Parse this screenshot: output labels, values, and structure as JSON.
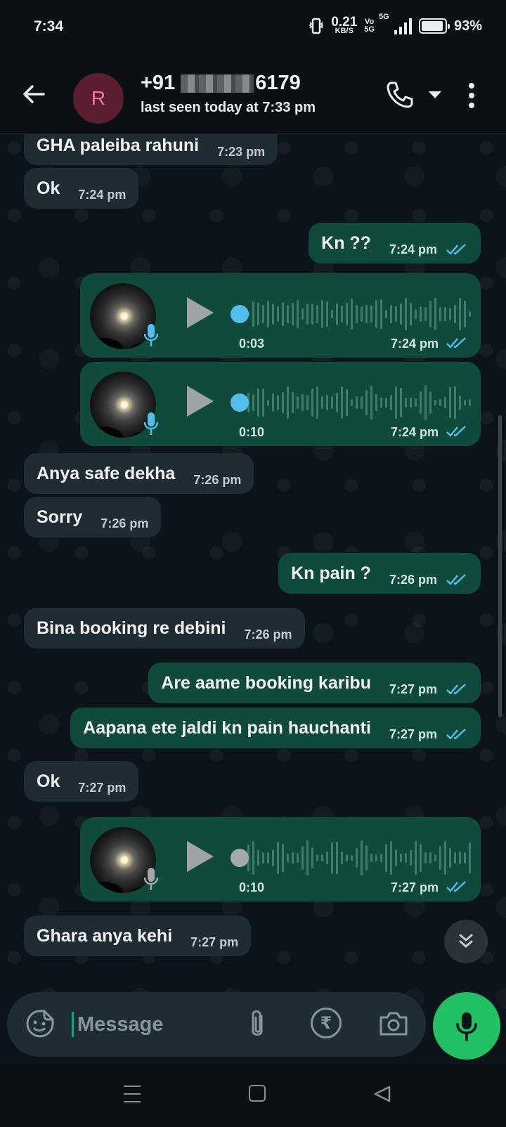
{
  "status_bar": {
    "time": "7:34",
    "speed_value": "0.21",
    "speed_unit": "KB/S",
    "vo_top": "Vo",
    "vo_bottom": "5G",
    "network": "5G",
    "battery": "93%",
    "battery_level": 0.93
  },
  "header": {
    "avatar_letter": "R",
    "number_prefix": "+91",
    "number_suffix": "6179",
    "last_seen": "last seen today at 7:33 pm",
    "avatar_color": "#5b1d30"
  },
  "messages": [
    {
      "dir": "in",
      "text": "GHA paleiba rahuni",
      "time": "7:23 pm"
    },
    {
      "dir": "in",
      "text": "Ok",
      "time": "7:24 pm"
    },
    {
      "dir": "out",
      "text": "Kn ??",
      "time": "7:24 pm",
      "status": "read"
    },
    {
      "dir": "out",
      "type": "voice",
      "duration": "0:03",
      "time": "7:24 pm",
      "status": "read",
      "progress": 0
    },
    {
      "dir": "out",
      "type": "voice",
      "duration": "0:10",
      "time": "7:24 pm",
      "status": "read",
      "progress": 0
    },
    {
      "dir": "in",
      "text": "Anya safe dekha",
      "time": "7:26 pm"
    },
    {
      "dir": "in",
      "text": "Sorry",
      "time": "7:26 pm"
    },
    {
      "dir": "out",
      "text": "Kn pain ?",
      "time": "7:26 pm",
      "status": "read"
    },
    {
      "dir": "in",
      "text": "Bina booking re debini",
      "time": "7:26 pm"
    },
    {
      "dir": "out",
      "text": "Are aame booking karibu",
      "time": "7:27 pm",
      "status": "read"
    },
    {
      "dir": "out",
      "text": "Aapana ete jaldi kn pain hauchanti",
      "time": "7:27 pm",
      "status": "read"
    },
    {
      "dir": "in",
      "text": "Ok",
      "time": "7:27 pm"
    },
    {
      "dir": "out",
      "type": "voice",
      "duration": "0:10",
      "time": "7:27 pm",
      "status": "read",
      "progress": 0
    },
    {
      "dir": "in",
      "text": "Ghara anya kehi",
      "time": "7:27 pm"
    }
  ],
  "composer": {
    "placeholder": "Message",
    "rupee_symbol": "₹"
  },
  "icons": [
    "back-arrow-icon",
    "phone-icon",
    "more-vert-icon",
    "play-icon",
    "mic-icon",
    "emoji-icon",
    "attach-icon",
    "rupee-icon",
    "camera-icon",
    "scroll-down-icon"
  ],
  "colors": {
    "accent": "#00a884",
    "mic_button": "#21c063",
    "outgoing_bubble": "#0f4a3c",
    "incoming_bubble": "#1f2c33",
    "read_tick": "#53bdeb"
  }
}
